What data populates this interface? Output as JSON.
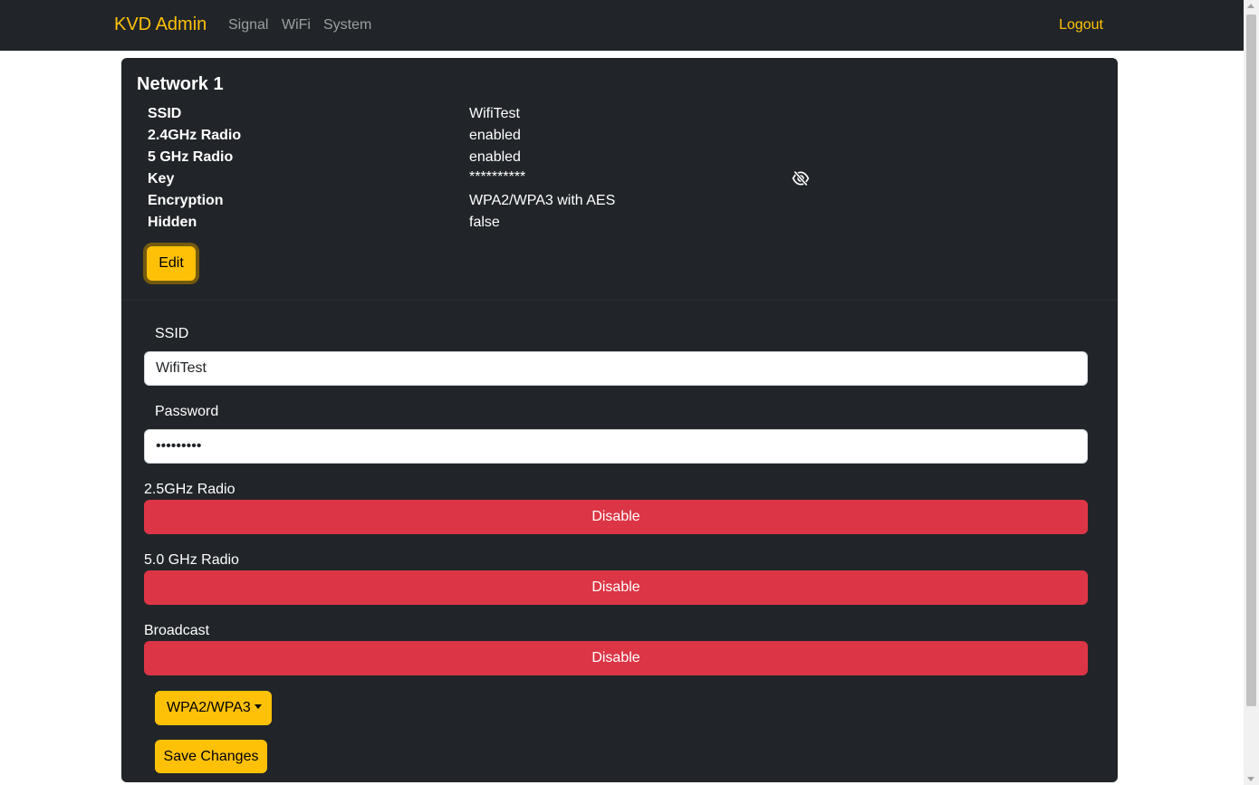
{
  "navbar": {
    "brand": "KVD Admin",
    "links": [
      "Signal",
      "WiFi",
      "System"
    ],
    "logout": "Logout"
  },
  "network": {
    "title": "Network 1",
    "rows": [
      {
        "label": "SSID",
        "value": "WifiTest"
      },
      {
        "label": "2.4GHz Radio",
        "value": "enabled"
      },
      {
        "label": "5 GHz Radio",
        "value": "enabled"
      },
      {
        "label": "Key",
        "value": "**********"
      },
      {
        "label": "Encryption",
        "value": "WPA2/WPA3 with AES"
      },
      {
        "label": "Hidden",
        "value": "false"
      }
    ],
    "edit_label": "Edit",
    "key_toggle_icon": "eye-slash-icon"
  },
  "form": {
    "ssid_label": "SSID",
    "ssid_value": "WifiTest",
    "password_label": "Password",
    "password_value": "•••••••••",
    "radio24_label": "2.5GHz Radio",
    "radio24_button": "Disable",
    "radio5_label": "5.0 GHz Radio",
    "radio5_button": "Disable",
    "broadcast_label": "Broadcast",
    "broadcast_button": "Disable",
    "encryption_dropdown": "WPA2/WPA3",
    "save_label": "Save Changes"
  },
  "colors": {
    "accent": "#ffc107",
    "danger": "#dc3545",
    "card_bg": "#212529"
  }
}
